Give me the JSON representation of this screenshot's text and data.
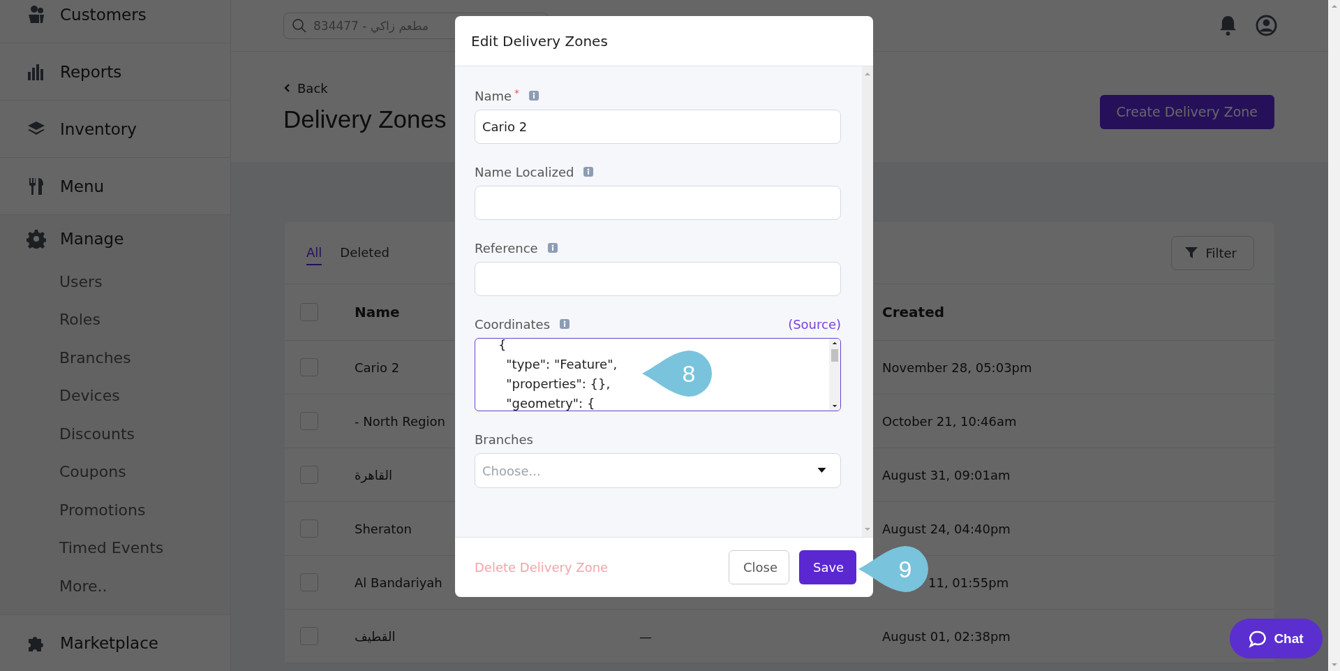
{
  "sidebar": {
    "items": [
      {
        "kind": "people",
        "label": "Customers"
      },
      {
        "kind": "chart",
        "label": "Reports"
      },
      {
        "kind": "layers",
        "label": "Inventory"
      },
      {
        "kind": "cutlery",
        "label": "Menu"
      },
      {
        "kind": "gear",
        "label": "Manage",
        "expanded": true,
        "children": [
          {
            "label": "Users"
          },
          {
            "label": "Roles"
          },
          {
            "label": "Branches"
          },
          {
            "label": "Devices"
          },
          {
            "label": "Discounts"
          },
          {
            "label": "Coupons"
          },
          {
            "label": "Promotions"
          },
          {
            "label": "Timed Events"
          },
          {
            "label": "More.."
          }
        ]
      },
      {
        "kind": "puzzle",
        "label": "Marketplace"
      }
    ]
  },
  "top_bar": {
    "search": {
      "placeholder": "834477 - مطعم زاكي"
    }
  },
  "header": {
    "back": "Back",
    "title": "Delivery Zones",
    "create_button": "Create Delivery Zone"
  },
  "table_card": {
    "tabs": [
      {
        "label": "All",
        "selected": true
      },
      {
        "label": "Deleted",
        "selected": false
      }
    ],
    "filter_button": "Filter",
    "select_all_checked": false,
    "columns": [
      "Name",
      "Created"
    ],
    "rows": [
      {
        "checked": false,
        "name": "Cario 2",
        "created": "November 28, 05:03pm"
      },
      {
        "checked": false,
        "name": "- North Region",
        "created": "October 21, 10:46am"
      },
      {
        "checked": false,
        "name": "القاهرة",
        "created": "August 31, 09:01am"
      },
      {
        "checked": false,
        "name": "Sheraton",
        "created": "August 24, 04:40pm"
      },
      {
        "checked": false,
        "name": "Al Bandariyah",
        "created": "11, 01:55pm"
      },
      {
        "checked": false,
        "name": "القطيف",
        "column_3": "—",
        "created": "August 01, 02:38pm"
      }
    ]
  },
  "modal": {
    "title": "Edit Delivery Zones",
    "fields": [
      {
        "kind": "text",
        "label": "Name",
        "required_mark": "*",
        "info": true,
        "value": "Cario 2"
      },
      {
        "kind": "text",
        "label": "Name Localized",
        "info": true
      },
      {
        "kind": "text",
        "label": "Reference",
        "info": true
      },
      {
        "kind": "code",
        "label": "Coordinates",
        "info": true,
        "link": "(Source)",
        "value": "    {\n      \"type\": \"Feature\",\n      \"properties\": {},\n      \"geometry\": {"
      },
      {
        "kind": "select",
        "label": "Branches",
        "info": false,
        "placeholder": "Choose..."
      }
    ],
    "delete_link": "Delete Delivery Zone",
    "buttons": [
      {
        "kind": "secondary",
        "label": "Close"
      },
      {
        "kind": "primary",
        "label": "Save"
      }
    ]
  },
  "markers": [
    {
      "number": "8"
    },
    {
      "number": "9"
    }
  ],
  "chat_button": "Chat"
}
